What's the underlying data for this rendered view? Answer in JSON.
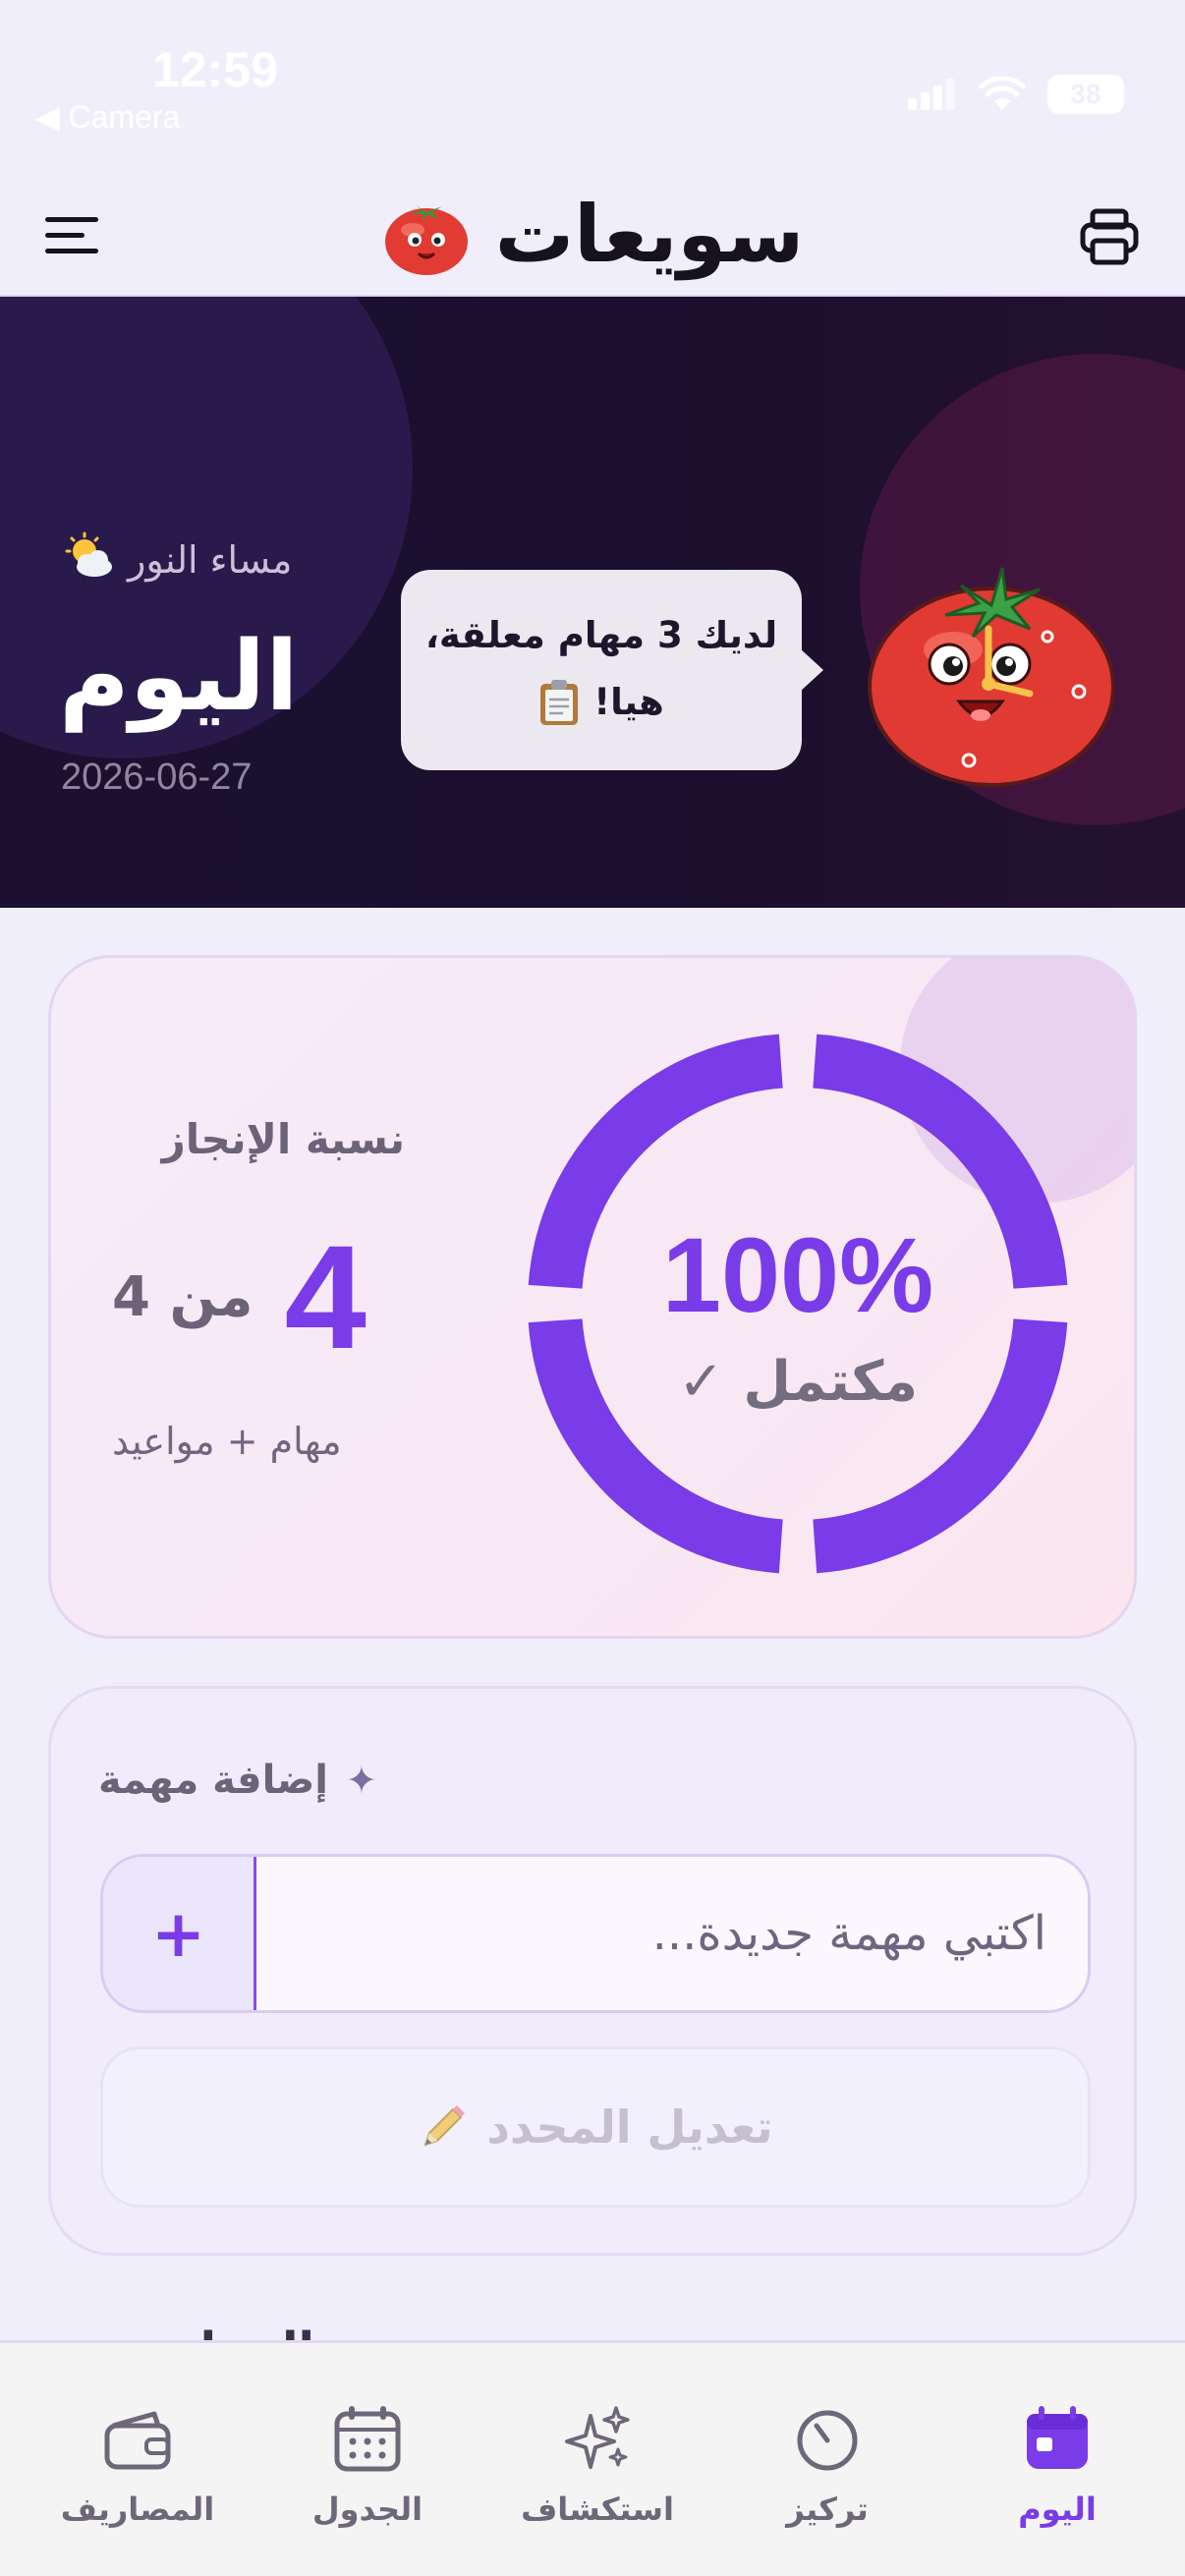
{
  "status_bar": {
    "time": "12:59",
    "back_label": "◀ Camera",
    "battery": "38",
    "icons": [
      "signal-icon",
      "wifi-icon",
      "battery-icon"
    ]
  },
  "header": {
    "title": "سويعات",
    "icons": [
      "menu-icon",
      "tomato-logo-icon",
      "print-icon"
    ]
  },
  "hero": {
    "greeting": "مساء النور",
    "greeting_emoji": "🌤️",
    "title": "اليوم",
    "date": "2026-06-27",
    "bubble_line1": "لديك 3 مهام معلقة،",
    "bubble_line2": "هيا!",
    "bubble_emoji": "📋"
  },
  "progress": {
    "label": "نسبة الإنجاز",
    "done": "4",
    "of_text": "من 4",
    "subtitle": "مهام + مواعيد",
    "percent_text": "100%",
    "percent_value": 100,
    "status": "مكتمل ✓",
    "accent": "#7a3be8"
  },
  "add_task": {
    "title": "إضافة مهمة",
    "title_icon": "sparkle-icon",
    "placeholder": "اكتبي مهمة جديدة...",
    "value": "",
    "add_button": "+",
    "edit_button": "تعديل المحدد",
    "edit_emoji": "✏️"
  },
  "peek": {
    "text": "المهام"
  },
  "nav": {
    "items": [
      {
        "label": "اليوم",
        "icon": "calendar-today-icon",
        "active": true
      },
      {
        "label": "تركيز",
        "icon": "timer-icon",
        "active": false
      },
      {
        "label": "استكشاف",
        "icon": "sparkles-icon",
        "active": false
      },
      {
        "label": "الجدول",
        "icon": "calendar-grid-icon",
        "active": false
      },
      {
        "label": "المصاريف",
        "icon": "wallet-icon",
        "active": false
      }
    ]
  },
  "colors": {
    "accent": "#7a3be8",
    "background": "#f1eefc",
    "hero_bg": "#1a0f2e"
  }
}
